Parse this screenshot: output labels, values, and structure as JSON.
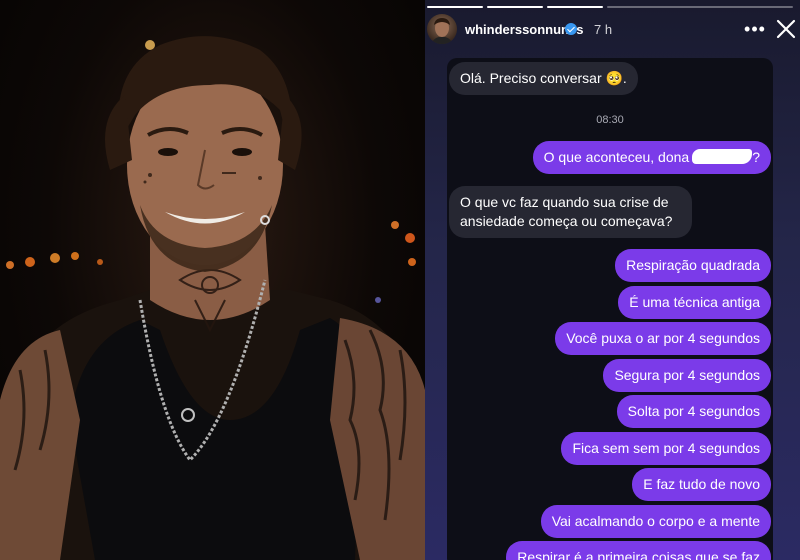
{
  "story": {
    "username": "whinderssonnunes",
    "time_ago": "7 h",
    "more_label": "•••"
  },
  "chat": {
    "timestamp": "08:30",
    "messages": [
      {
        "dir": "in",
        "text": "Olá. Preciso conversar 🥺."
      },
      {
        "dir": "out",
        "text": "O que aconteceu, dona",
        "redacted": true,
        "suffix": "?"
      },
      {
        "dir": "in",
        "lines": [
          "O que vc faz quando sua crise de",
          "ansiedade começa ou começava?"
        ]
      },
      {
        "dir": "out",
        "text": "Respiração quadrada"
      },
      {
        "dir": "out",
        "text": "É uma técnica antiga"
      },
      {
        "dir": "out",
        "text": "Você puxa o ar por 4 segundos"
      },
      {
        "dir": "out",
        "text": "Segura por 4 segundos"
      },
      {
        "dir": "out",
        "text": "Solta por 4 segundos"
      },
      {
        "dir": "out",
        "text": "Fica sem sem por 4 segundos"
      },
      {
        "dir": "out",
        "text": "E faz tudo de novo"
      },
      {
        "dir": "out",
        "text": "Vai acalmando o corpo e a mente"
      },
      {
        "dir": "out",
        "text": "Respirar é a primeira coisas que se faz"
      }
    ]
  },
  "colors": {
    "outgoing_bubble": "#7b3be9",
    "incoming_bubble": "#262732",
    "chat_background": "#0d0e17"
  }
}
